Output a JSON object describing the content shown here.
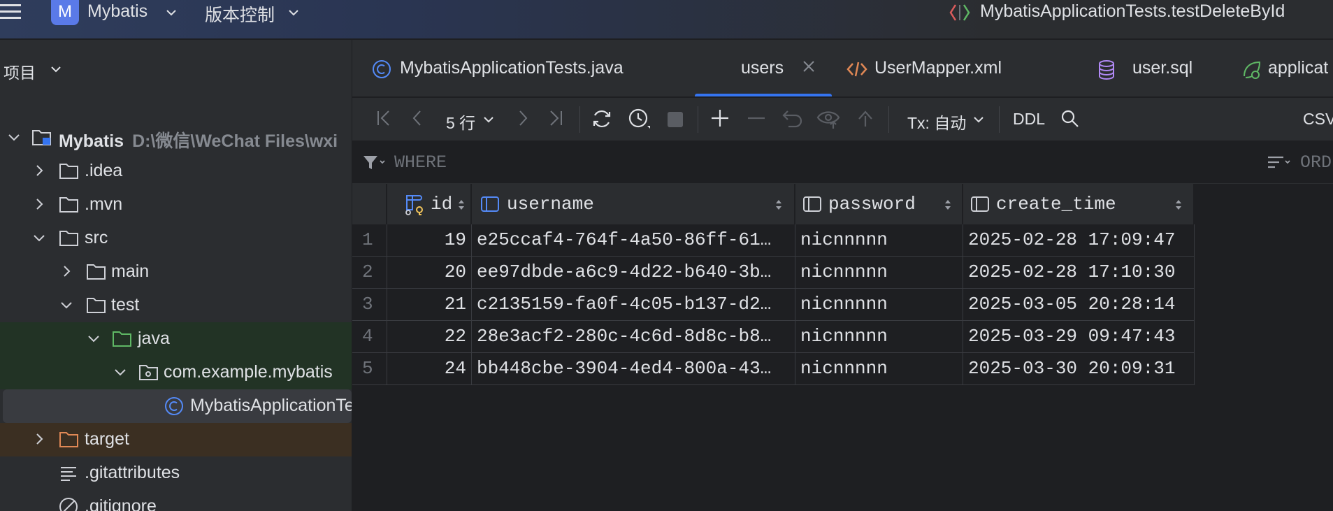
{
  "titlebar": {
    "project_badge": "M",
    "project_name": "Mybatis",
    "vcs_label": "版本控制",
    "run_config": "MybatisApplicationTests.testDeleteById"
  },
  "project_panel": {
    "title": "项目",
    "root": {
      "label": "Mybatis",
      "path": "D:\\微信\\WeChat Files\\wxi"
    },
    "items": [
      {
        "label": ".idea"
      },
      {
        "label": ".mvn"
      },
      {
        "label": "src"
      },
      {
        "label": "main"
      },
      {
        "label": "test"
      },
      {
        "label": "java"
      },
      {
        "label": "com.example.mybatis"
      },
      {
        "label": "MybatisApplicationTests"
      },
      {
        "label": "target"
      },
      {
        "label": ".gitattributes"
      },
      {
        "label": ".gitignore"
      }
    ]
  },
  "tabs": [
    {
      "label": "MybatisApplicationTests.java",
      "icon": "java-class-icon"
    },
    {
      "label": "users",
      "icon": "",
      "active": true
    },
    {
      "label": "UserMapper.xml",
      "icon": "xml-icon"
    },
    {
      "label": "user.sql",
      "icon": "database-icon"
    },
    {
      "label": "applicat",
      "icon": "spring-icon"
    }
  ],
  "toolbar": {
    "rows_label": "5 行",
    "tx_label": "Tx: 自动",
    "ddl_label": "DDL",
    "csv_label": "CSV"
  },
  "filter": {
    "where_label": "WHERE",
    "order_label": "ORDER BY"
  },
  "table": {
    "columns": [
      "id",
      "username",
      "password",
      "create_time"
    ],
    "rows": [
      {
        "n": "1",
        "id": "19",
        "username": "e25ccaf4-764f-4a50-86ff-61…",
        "password": "nicnnnnn",
        "create_time": "2025-02-28 17:09:47"
      },
      {
        "n": "2",
        "id": "20",
        "username": "ee97dbde-a6c9-4d22-b640-3b…",
        "password": "nicnnnnn",
        "create_time": "2025-02-28 17:10:30"
      },
      {
        "n": "3",
        "id": "21",
        "username": "c2135159-fa0f-4c05-b137-d2…",
        "password": "nicnnnnn",
        "create_time": "2025-03-05 20:28:14"
      },
      {
        "n": "4",
        "id": "22",
        "username": "28e3acf2-280c-4c6d-8d8c-b8…",
        "password": "nicnnnnn",
        "create_time": "2025-03-29 09:47:43"
      },
      {
        "n": "5",
        "id": "24",
        "username": "bb448cbe-3904-4ed4-800a-43…",
        "password": "nicnnnnn",
        "create_time": "2025-03-30 20:09:31"
      }
    ]
  },
  "colors": {
    "accent": "#3574f0",
    "project_badge": "#5a7ae8",
    "java_folder_bg": "#223325",
    "target_folder_bg": "#3b2f22"
  }
}
